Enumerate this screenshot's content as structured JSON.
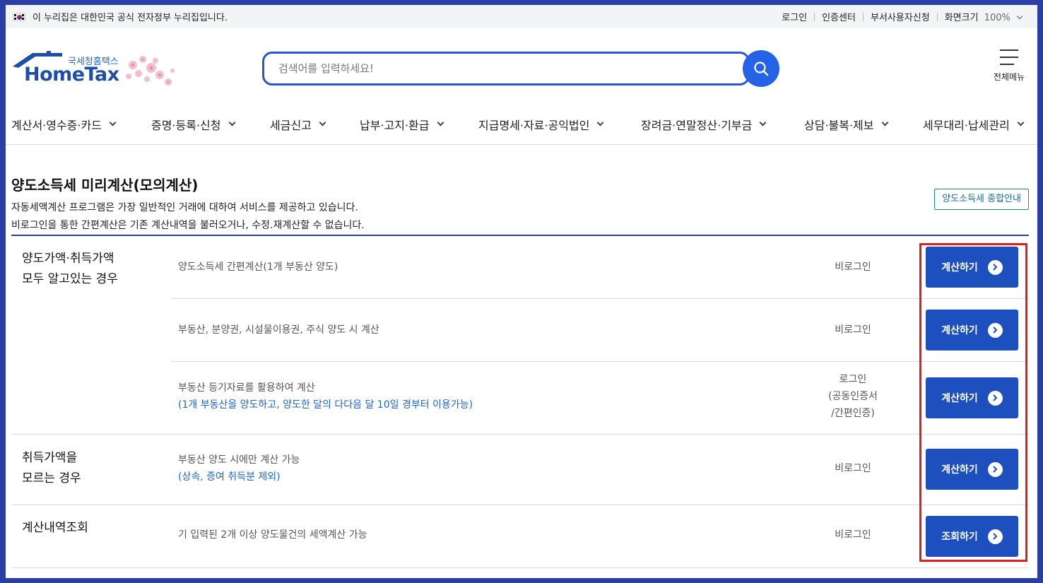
{
  "topbar": {
    "gov_notice": "이 누리집은 대한민국 공식 전자정부 누리집입니다.",
    "links": [
      "로그인",
      "인증센터",
      "부서사용자신청"
    ],
    "zoom_label": "화면크기",
    "zoom_value": "100%"
  },
  "header": {
    "logo_text": "HomeTax",
    "logo_ko": "국세청홈택스",
    "search_placeholder": "검색어를 입력하세요!",
    "menu_label": "전체메뉴"
  },
  "gnb": {
    "items": [
      "계산서·영수증·카드",
      "증명·등록·신청",
      "세금신고",
      "납부·고지·환급",
      "지급명세·자료·공익법인",
      "장려금·연말정산·기부금",
      "상담·불복·제보",
      "세무대리·납세관리"
    ]
  },
  "page": {
    "title": "양도소득세 미리계산(모의계산)",
    "desc1": "자동세액계산 프로그램은 가장 일반적인 거래에 대하여 서비스를 제공하고 있습니다.",
    "desc2": "비로그인을 통한 간편계산은 기존 계산내역을 불러오거나, 수정.재계산할 수 없습니다.",
    "guide_button": "양도소득세 종합안내"
  },
  "groups": [
    {
      "label_line1": "양도가액·취득가액",
      "label_line2": "모두 알고있는 경우",
      "rows": [
        {
          "desc": "양도소득세 간편계산(1개 부동산 양도)",
          "note": "",
          "login": "비로그인",
          "button": "계산하기"
        },
        {
          "desc": "부동산, 분양권, 시설물이용권, 주식 양도 시 계산",
          "note": "",
          "login": "비로그인",
          "button": "계산하기"
        },
        {
          "desc": "부동산 등기자료를 활용하여 계산",
          "note": "(1개 부동산을 양도하고, 양도한 달의 다다음 달 10일 경부터 이용가능)",
          "login_line1": "로그인",
          "login_line2": "(공동인증서",
          "login_line3": "/간편인증)",
          "button": "계산하기"
        }
      ]
    },
    {
      "label_line1": "취득가액을",
      "label_line2": "모르는 경우",
      "rows": [
        {
          "desc": "부동산 양도 시에만 계산 가능",
          "note": "(상속, 증여 취득분 제외)",
          "login": "비로그인",
          "button": "계산하기"
        }
      ]
    },
    {
      "label_line1": "계산내역조회",
      "rows": [
        {
          "desc": "기 입력된 2개 이상 양도물건의 세액계산 가능",
          "login": "비로그인",
          "button": "조회하기"
        }
      ]
    }
  ],
  "colors": {
    "primary_button": "#1e4fbf",
    "highlight_border": "#e21d1d",
    "note_text": "#1a63d8",
    "frame": "#2a3fa5"
  }
}
